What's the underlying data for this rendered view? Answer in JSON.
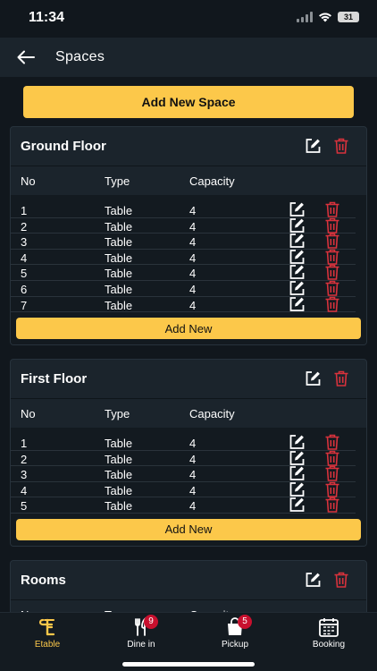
{
  "status": {
    "time": "11:34",
    "battery": "31"
  },
  "header": {
    "title": "Spaces"
  },
  "add_space_label": "Add New Space",
  "columns": {
    "no": "No",
    "type": "Type",
    "capacity": "Capacity"
  },
  "add_new_label": "Add New",
  "spaces": [
    {
      "title": "Ground Floor",
      "rows": [
        {
          "no": "1",
          "type": "Table",
          "capacity": "4"
        },
        {
          "no": "2",
          "type": "Table",
          "capacity": "4"
        },
        {
          "no": "3",
          "type": "Table",
          "capacity": "4"
        },
        {
          "no": "4",
          "type": "Table",
          "capacity": "4"
        },
        {
          "no": "5",
          "type": "Table",
          "capacity": "4"
        },
        {
          "no": "6",
          "type": "Table",
          "capacity": "4"
        },
        {
          "no": "7",
          "type": "Table",
          "capacity": "4"
        }
      ]
    },
    {
      "title": "First Floor",
      "rows": [
        {
          "no": "1",
          "type": "Table",
          "capacity": "4"
        },
        {
          "no": "2",
          "type": "Table",
          "capacity": "4"
        },
        {
          "no": "3",
          "type": "Table",
          "capacity": "4"
        },
        {
          "no": "4",
          "type": "Table",
          "capacity": "4"
        },
        {
          "no": "5",
          "type": "Table",
          "capacity": "4"
        }
      ]
    },
    {
      "title": "Rooms",
      "rows": []
    }
  ],
  "tabs": [
    {
      "label": "Etable",
      "icon": "etable-logo-icon",
      "badge": ""
    },
    {
      "label": "Dine in",
      "icon": "fork-knife-icon",
      "badge": "9"
    },
    {
      "label": "Pickup",
      "icon": "shopping-bag-icon",
      "badge": "5"
    },
    {
      "label": "Booking",
      "icon": "calendar-icon",
      "badge": ""
    }
  ],
  "colors": {
    "accent": "#fcc84a",
    "delete": "#d8323c",
    "badge": "#c8102e",
    "card": "#1b242c",
    "background": "#11171d"
  }
}
